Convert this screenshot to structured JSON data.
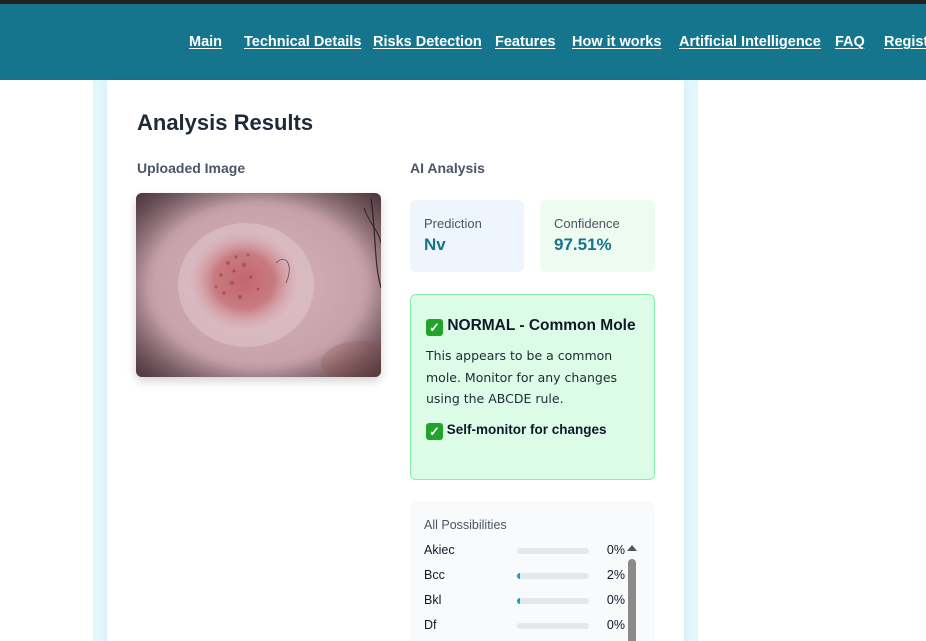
{
  "nav": {
    "items": [
      "Main",
      "Technical Details",
      "Risks Detection",
      "Features",
      "How it works",
      "Artificial Intelligence",
      "FAQ",
      "Register"
    ]
  },
  "results": {
    "title": "Analysis Results",
    "uploaded_label": "Uploaded Image",
    "ai_label": "AI Analysis",
    "prediction_label": "Prediction",
    "prediction_value": "Nv",
    "confidence_label": "Confidence",
    "confidence_value": "97.51%",
    "verdict_title": "NORMAL - Common Mole",
    "verdict_description": "This appears to be a common mole. Monitor for any changes using the ABCDE rule.",
    "verdict_advice": "Self-monitor for changes"
  },
  "possibilities": {
    "title": "All Possibilities",
    "items": [
      {
        "name": "Akiec",
        "percent": "0%",
        "fill": 0.0
      },
      {
        "name": "Bcc",
        "percent": "2%",
        "fill": 0.02
      },
      {
        "name": "Bkl",
        "percent": "0%",
        "fill": 0.004
      },
      {
        "name": "Df",
        "percent": "0%",
        "fill": 0.0
      }
    ]
  },
  "colors": {
    "header": "#15758d",
    "accent": "#15758d",
    "normal_bg": "#dcfce7",
    "bar_fill": "#06a6c9"
  }
}
